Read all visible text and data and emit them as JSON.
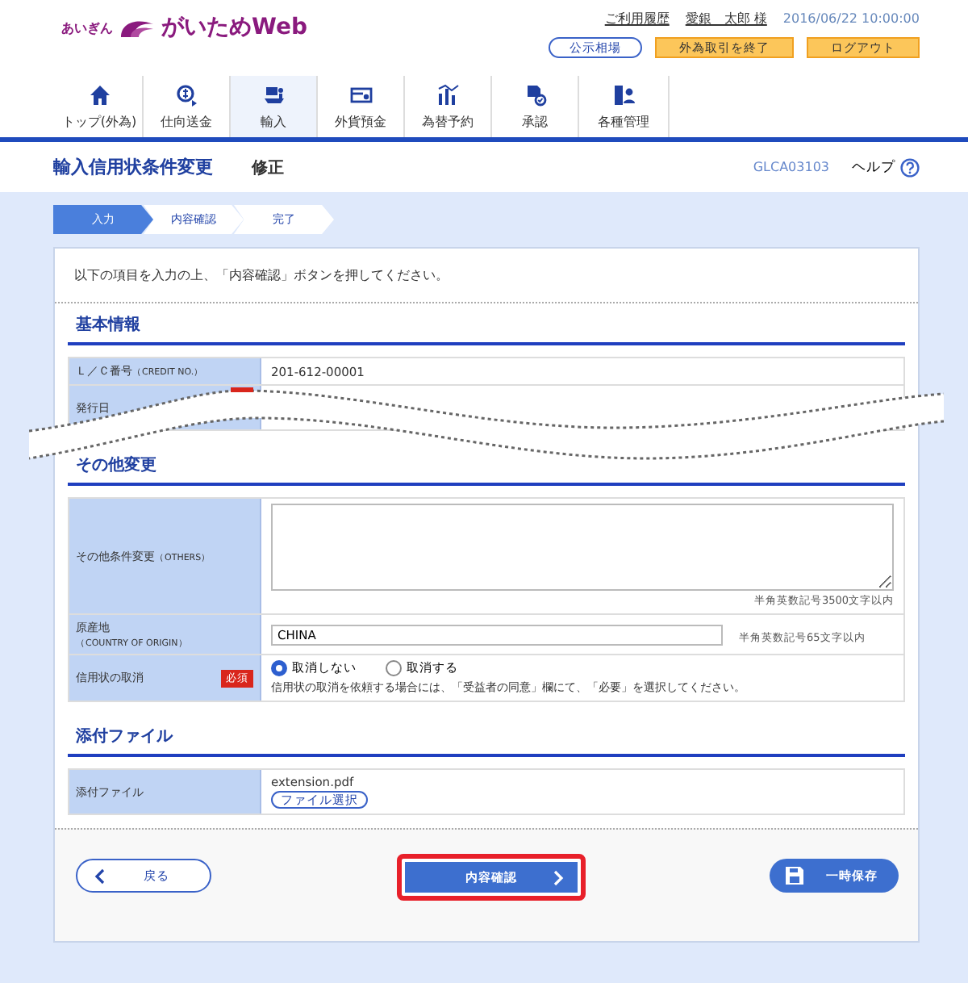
{
  "header": {
    "logo_prefix": "あいぎん",
    "logo_text": "がいためWeb",
    "links": [
      "ご利用履歴",
      "愛銀　太郎 様"
    ],
    "datetime": "2016/06/22 10:00:00",
    "buttons": [
      {
        "label": "公示相場",
        "kind": "outline"
      },
      {
        "label": "外為取引を終了",
        "kind": "warning"
      },
      {
        "label": "ログアウト",
        "kind": "warning"
      }
    ]
  },
  "nav": [
    {
      "label": "トップ(外為)",
      "selected": false
    },
    {
      "label": "仕向送金",
      "selected": false
    },
    {
      "label": "輸入",
      "selected": true
    },
    {
      "label": "外貨預金",
      "selected": false
    },
    {
      "label": "為替予約",
      "selected": false
    },
    {
      "label": "承認",
      "selected": false
    },
    {
      "label": "各種管理",
      "selected": false
    }
  ],
  "page": {
    "title": "輸入信用状条件変更",
    "subtitle": "修正",
    "screen_id": "GLCA03103",
    "help": "ヘルプ"
  },
  "steps": [
    {
      "label": "入力",
      "selected": true
    },
    {
      "label": "内容確認",
      "selected": false
    },
    {
      "label": "完了",
      "selected": false
    }
  ],
  "instruction": "以下の項目を入力の上、「内容確認」ボタンを押してください。",
  "sections": [
    {
      "title": "基本情報",
      "torn": true,
      "rows": [
        {
          "kind": "text",
          "label": "Ｌ／Ｃ番号",
          "label_en": "（CREDIT NO.）",
          "value": "201-612-00001"
        },
        {
          "kind": "cut",
          "label": "発行日",
          "required": true
        }
      ]
    },
    {
      "title": "その他変更",
      "rows": [
        {
          "kind": "textarea",
          "label": "その他条件変更",
          "label_en": "（OTHERS）",
          "hint": "半角英数記号3500文字以内"
        },
        {
          "kind": "input",
          "label": "原産地",
          "label_en": "（COUNTRY OF ORIGIN）",
          "en_below": true,
          "value": "CHINA",
          "hint": "半角英数記号65文字以内"
        },
        {
          "kind": "radio",
          "label": "信用状の取消",
          "required": true,
          "required_label": "必須",
          "options": [
            {
              "label": "取消しない",
              "selected": true
            },
            {
              "label": "取消する",
              "selected": false
            }
          ],
          "note": "信用状の取消を依頼する場合には、「受益者の同意」欄にて、「必要」を選択してください。"
        }
      ]
    },
    {
      "title": "添付ファイル",
      "rows": [
        {
          "kind": "file",
          "label": "添付ファイル",
          "file_name": "extension.pdf",
          "button": "ファイル選択"
        }
      ]
    }
  ],
  "footer": {
    "back": "戻る",
    "confirm": "内容確認",
    "confirm_highlighted": true,
    "save": "一時保存"
  }
}
